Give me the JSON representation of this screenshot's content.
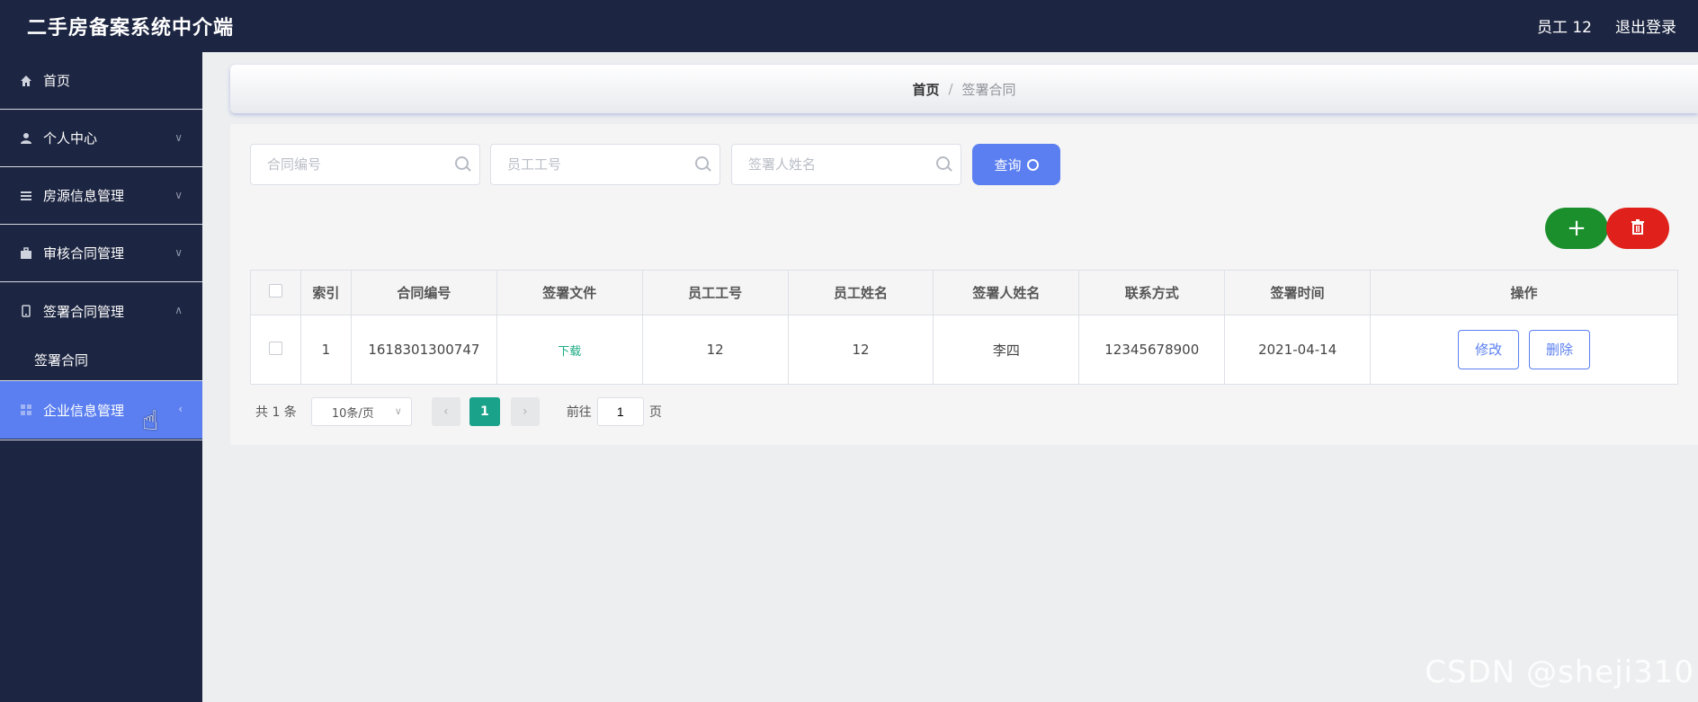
{
  "header": {
    "title": "二手房备案系统中介端",
    "user_label": "员工 12",
    "logout_label": "退出登录"
  },
  "sidebar": {
    "items": [
      {
        "label": "首页",
        "icon": "home-icon"
      },
      {
        "label": "个人中心",
        "icon": "user-icon"
      },
      {
        "label": "房源信息管理",
        "icon": "list-icon"
      },
      {
        "label": "审核合同管理",
        "icon": "briefcase-icon"
      },
      {
        "label": "签署合同管理",
        "icon": "mobile-icon"
      },
      {
        "label": "企业信息管理",
        "icon": "grid-icon"
      }
    ],
    "sub_items": [
      {
        "label": "签署合同"
      }
    ]
  },
  "breadcrumb": {
    "home": "首页",
    "separator": "/",
    "current": "签署合同"
  },
  "search": {
    "contract_no_placeholder": "合同编号",
    "employee_no_placeholder": "员工工号",
    "signer_name_placeholder": "签署人姓名",
    "query_label": "查询"
  },
  "actions": {
    "add_label": "+",
    "add_color": "#1a8f2c",
    "delete_color": "#e0211b"
  },
  "table": {
    "headers": [
      "索引",
      "合同编号",
      "签署文件",
      "员工工号",
      "员工姓名",
      "签署人姓名",
      "联系方式",
      "签署时间",
      "操作"
    ],
    "rows": [
      {
        "index": "1",
        "contract_no": "1618301300747",
        "file_link": "下载",
        "employee_no": "12",
        "employee_name": "12",
        "signer_name": "李四",
        "phone": "12345678900",
        "sign_time": "2021-04-14",
        "edit_label": "修改",
        "delete_label": "删除"
      }
    ]
  },
  "pagination": {
    "total": "共 1 条",
    "page_size": "10条/页",
    "current_page": "1",
    "goto_label": "前往",
    "goto_value": "1",
    "page_suffix": "页"
  },
  "watermark": "CSDN @sheji310",
  "colors": {
    "nav_bg": "#1c2541",
    "accent": "#5b7ff0",
    "pager_active": "#1aa28a"
  }
}
